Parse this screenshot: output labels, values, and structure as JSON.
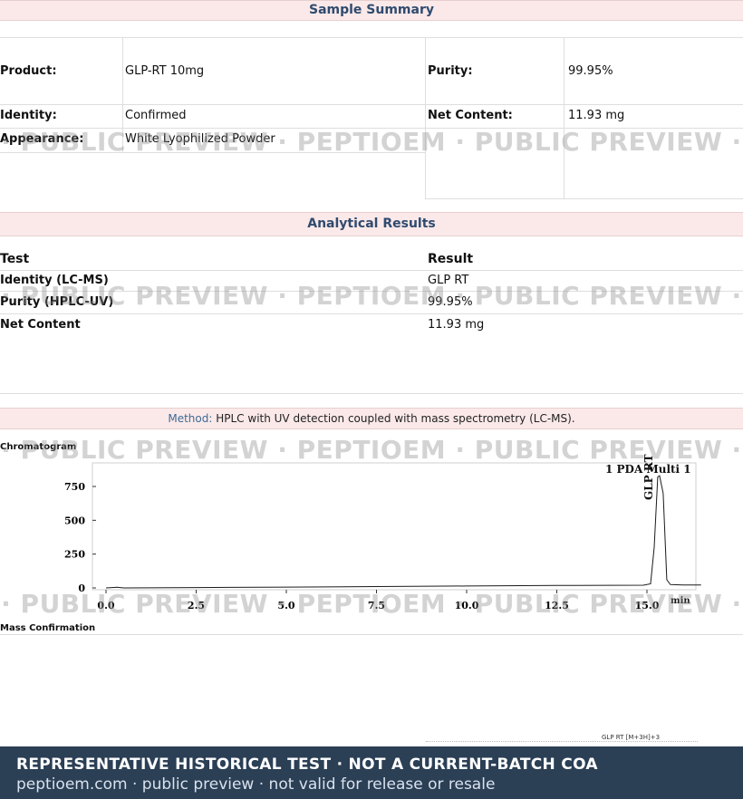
{
  "sample_summary": {
    "title": "Sample Summary",
    "product_label": "Product:",
    "product_value": "GLP-RT 10mg",
    "identity_label": "Identity:",
    "identity_value": "Confirmed",
    "appearance_label": "Appearance:",
    "appearance_value": "White Lyophilized Powder",
    "purity_label": "Purity:",
    "purity_value": "99.95%",
    "net_content_label": "Net Content:",
    "net_content_value": "11.93 mg"
  },
  "analytical_results": {
    "title": "Analytical Results",
    "headers": {
      "test": "Test",
      "result": "Result"
    },
    "rows": [
      {
        "test": "Identity (LC-MS)",
        "result": "GLP RT"
      },
      {
        "test": "Purity (HPLC-UV)",
        "result": "99.95%"
      },
      {
        "test": "Net Content",
        "result": "11.93 mg"
      }
    ]
  },
  "method": {
    "label": "Method:",
    "text": " HPLC with UV detection coupled with mass spectrometry (LC-MS)."
  },
  "chromatogram": {
    "section_label": "Chromatogram",
    "detector_label": "1 PDA Multi 1",
    "peak_label": "GLP RT",
    "x_unit": "min",
    "chart_data": {
      "type": "line",
      "xlim": [
        0,
        16.5
      ],
      "ylim": [
        0,
        850
      ],
      "x_ticks": [
        "0.0",
        "2.5",
        "5.0",
        "7.5",
        "10.0",
        "12.5",
        "15.0"
      ],
      "y_ticks": [
        "0",
        "250",
        "500",
        "750"
      ],
      "series": [
        {
          "x": [
            0,
            0.3,
            0.5,
            2.5,
            5.0,
            7.5,
            10.0,
            12.5,
            14.9,
            15.1,
            15.2,
            15.3,
            15.35,
            15.45,
            15.55,
            15.65,
            16.0,
            16.5
          ],
          "y": [
            0,
            5,
            0,
            3,
            6,
            10,
            14,
            18,
            20,
            30,
            300,
            820,
            830,
            700,
            60,
            25,
            22,
            22
          ]
        }
      ]
    }
  },
  "mass_confirmation": {
    "section_label": "Mass Confirmation",
    "ion_label": "GLP RT [M+3H]+3"
  },
  "watermark": {
    "text": "I · PUBLIC PREVIEW · PEPTIOEM · PUBLIC PREVIEW · PEPTI · PUBLIC"
  },
  "footer": {
    "line1": "REPRESENTATIVE HISTORICAL TEST · NOT A CURRENT-BATCH COA",
    "line2": "peptioem.com · public preview · not valid for release or resale"
  }
}
